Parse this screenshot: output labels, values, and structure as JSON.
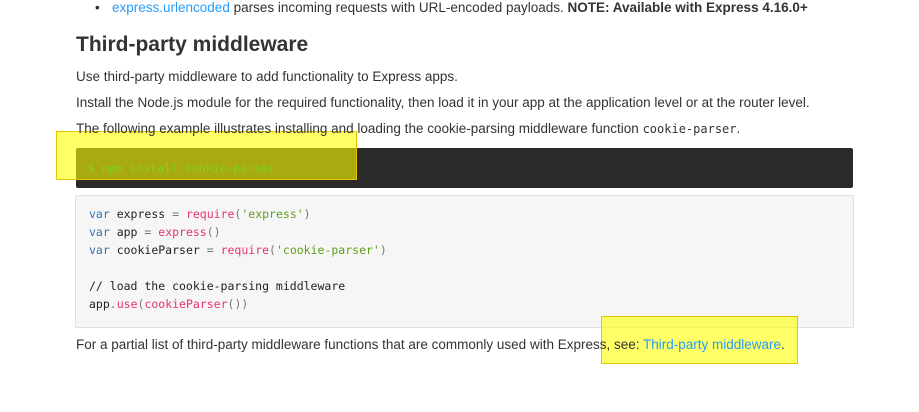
{
  "bullet": {
    "link": "express.urlencoded",
    "text": " parses incoming requests with URL-encoded payloads. ",
    "note": "NOTE: Available with Express 4.16.0+"
  },
  "section": {
    "heading": "Third-party middleware",
    "p1": "Use third-party middleware to add functionality to Express apps.",
    "p2": "Install the Node.js module for the required functionality, then load it in your app at the application level or at the router level.",
    "p3_text": "The following example illustrates installing and loading the cookie-parsing middleware function ",
    "p3_code": "cookie-parser",
    "p3_end": "."
  },
  "terminal": {
    "command": "$ npm install cookie-parser"
  },
  "code": {
    "l1": {
      "kw": "var",
      "name": " express ",
      "op": "=",
      "fn": " require",
      "p1": "(",
      "str": "'express'",
      "p2": ")"
    },
    "l2": {
      "kw": "var",
      "name": " app ",
      "op": "=",
      "fn": " express",
      "p1": "()"
    },
    "l3": {
      "kw": "var",
      "name": " cookieParser ",
      "op": "=",
      "fn": " require",
      "p1": "(",
      "str": "'cookie-parser'",
      "p2": ")"
    },
    "l4": {
      "comment": "// load the cookie-parsing middleware"
    },
    "l5": {
      "obj": "app",
      "dot": ".",
      "fn": "use",
      "p1": "(",
      "fn2": "cookieParser",
      "p2": "())"
    }
  },
  "footer": {
    "text": "For a partial list of third-party middleware functions that are commonly used with Express, see: ",
    "link": "Third-party middleware",
    "end": "."
  }
}
